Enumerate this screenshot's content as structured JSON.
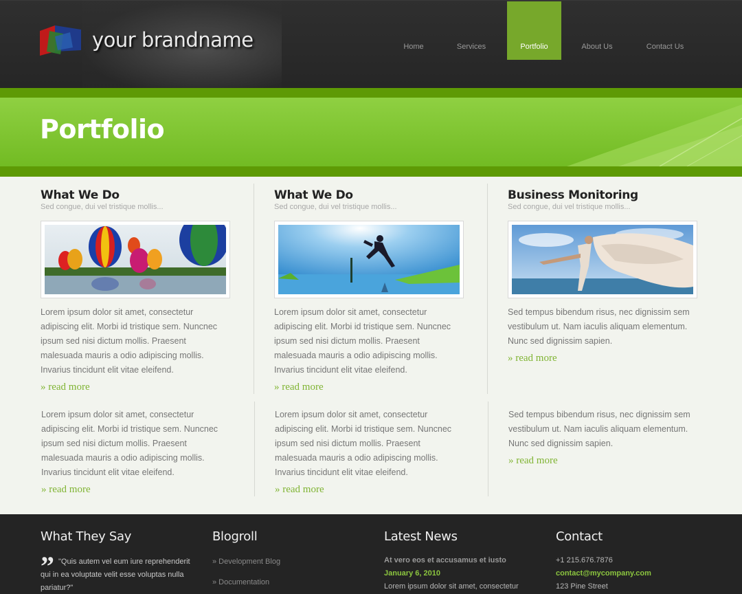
{
  "brand": {
    "name": "your brandname"
  },
  "nav": {
    "items": [
      {
        "label": "Home"
      },
      {
        "label": "Services"
      },
      {
        "label": "Portfolio"
      },
      {
        "label": "About Us"
      },
      {
        "label": "Contact Us"
      }
    ],
    "active": "Portfolio"
  },
  "hero": {
    "title": "Portfolio"
  },
  "columns": [
    {
      "title": "What We Do",
      "subtitle": "Sed congue, dui vel tristique mollis...",
      "image": "hot-air-balloons",
      "text": "Lorem ipsum dolor sit amet, consectetur adipiscing elit. Morbi id tristique sem. Nuncnec ipsum sed nisi dictum mollis. Praesent malesuada mauris a odio adipiscing mollis. Invarius tincidunt elit vitae eleifend.",
      "more": "» read more"
    },
    {
      "title": "What We Do",
      "subtitle": "Sed congue, dui vel tristique mollis...",
      "image": "jumping-man-sky",
      "text": "Lorem ipsum dolor sit amet, consectetur adipiscing elit. Morbi id tristique sem. Nuncnec ipsum sed nisi dictum mollis. Praesent malesuada mauris a odio adipiscing mollis. Invarius tincidunt elit vitae eleifend.",
      "more": "» read more"
    },
    {
      "title": "Business Monitoring",
      "subtitle": "Sed congue, dui vel tristique mollis...",
      "image": "woman-flowing-cloth",
      "text": "Sed tempus bibendum risus, nec dignissim sem vestibulum ut. Nam iaculis aliquam elementum. Nunc sed dignissim sapien.",
      "more": "» read more"
    }
  ],
  "row2": [
    {
      "text": "Lorem ipsum dolor sit amet, consectetur adipiscing elit. Morbi id tristique sem. Nuncnec ipsum sed nisi dictum mollis. Praesent malesuada mauris a odio adipiscing mollis. Invarius tincidunt elit vitae eleifend.",
      "more": "» read more"
    },
    {
      "text": "Lorem ipsum dolor sit amet, consectetur adipiscing elit. Morbi id tristique sem. Nuncnec ipsum sed nisi dictum mollis. Praesent malesuada mauris a odio adipiscing mollis. Invarius tincidunt elit vitae eleifend.",
      "more": "» read more"
    },
    {
      "text": "Sed tempus bibendum risus, nec dignissim sem vestibulum ut. Nam iaculis aliquam elementum. Nunc sed dignissim sapien.",
      "more": "» read more"
    }
  ],
  "footer": {
    "testimonials": {
      "title": "What They Say",
      "quote": "\"Quis autem vel eum iure reprehenderit qui in ea voluptate velit esse voluptas nulla pariatur?\""
    },
    "blogroll": {
      "title": "Blogroll",
      "links": [
        "» Development Blog",
        "» Documentation"
      ]
    },
    "news": {
      "title": "Latest News",
      "headline": "At vero eos et accusamus et iusto",
      "date": "January 6, 2010",
      "excerpt": "Lorem ipsum dolor sit amet, consectetur"
    },
    "contact": {
      "title": "Contact",
      "phone": "+1 215.676.7876",
      "email": "contact@mycompany.com",
      "street": "123 Pine Street"
    }
  },
  "colors": {
    "accent": "#77a82b",
    "green_band": "#7fc433",
    "link": "#80b434",
    "dark": "#262626"
  }
}
